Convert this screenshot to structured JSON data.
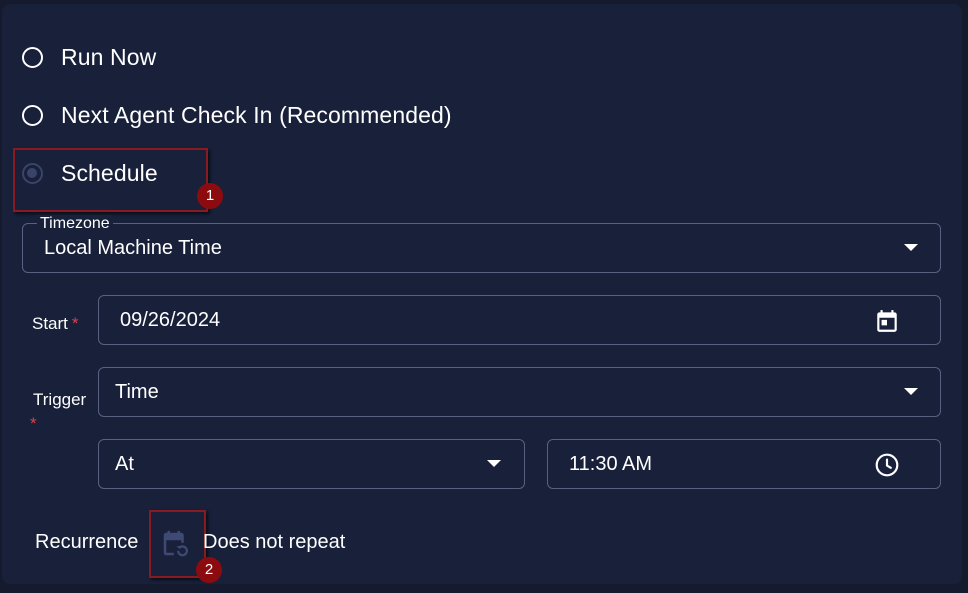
{
  "options": {
    "run_now": "Run Now",
    "next_check_in": "Next Agent Check In (Recommended)",
    "schedule": "Schedule"
  },
  "timezone": {
    "legend": "Timezone",
    "value": "Local Machine Time"
  },
  "start": {
    "label": "Start",
    "required_mark": "*",
    "value": "09/26/2024",
    "icon": "calendar-icon"
  },
  "trigger": {
    "label": "Trigger",
    "required_mark": "*",
    "value": "Time"
  },
  "at": {
    "value": "At"
  },
  "time": {
    "value": "11:30 AM",
    "icon": "clock-icon"
  },
  "recurrence": {
    "label": "Recurrence",
    "icon": "calendar-repeat-icon",
    "value": "Does not repeat"
  },
  "annotations": [
    "1",
    "2"
  ],
  "colors": {
    "background": "#18203a",
    "border": "#5a6180",
    "required": "#e0404a",
    "badge": "#8c0b0e"
  }
}
